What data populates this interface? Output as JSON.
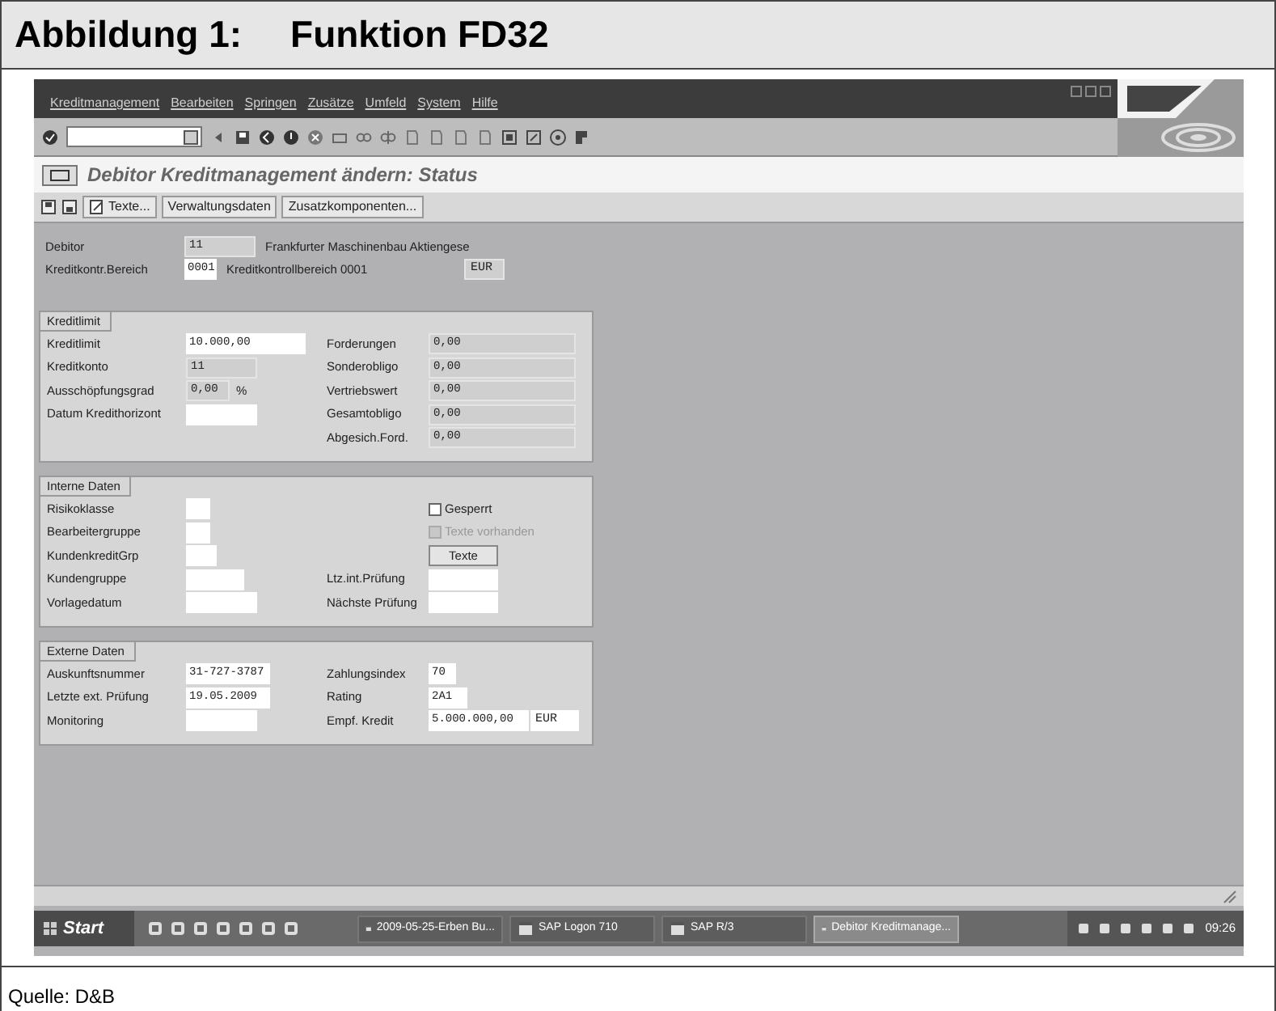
{
  "figure": {
    "caption_label": "Abbildung 1:",
    "caption_title": "Funktion FD32",
    "source": "Quelle: D&B"
  },
  "window": {
    "menu": [
      "Kreditmanagement",
      "Bearbeiten",
      "Springen",
      "Zusätze",
      "Umfeld",
      "System",
      "Hilfe"
    ],
    "title": "Debitor Kreditmanagement ändern: Status"
  },
  "app_toolbar": [
    "Texte...",
    "Verwaltungsdaten",
    "Zusatzkomponenten..."
  ],
  "header_fields": [
    {
      "label": "Debitor",
      "value": "11",
      "editable": false,
      "description": "Frankfurter Maschinenbau Aktiengese"
    },
    {
      "label": "Kreditkontr.Bereich",
      "value": "0001",
      "editable": true,
      "description": "Kreditkontrollbereich 0001",
      "currency": "EUR"
    }
  ],
  "groups": [
    {
      "title": "Kreditlimit",
      "left": [
        {
          "kind": "field",
          "label": "Kreditlimit",
          "value": "10.000,00",
          "editable": true
        },
        {
          "kind": "field",
          "label": "Kreditkonto",
          "value": "11",
          "editable": false
        },
        {
          "kind": "field",
          "label": "Ausschöpfungsgrad",
          "value": "0,00",
          "editable": false,
          "unit": "%"
        },
        {
          "kind": "field",
          "label": "Datum Kredithorizont",
          "editable": true
        }
      ],
      "right": [
        {
          "kind": "field",
          "label": "Forderungen",
          "value": "0,00",
          "editable": false
        },
        {
          "kind": "field",
          "label": "Sonderobligo",
          "value": "0,00",
          "editable": false
        },
        {
          "kind": "field",
          "label": "Vertriebswert",
          "value": "0,00",
          "editable": false
        },
        {
          "kind": "field",
          "label": "Gesamtobligo",
          "value": "0,00",
          "editable": false
        },
        {
          "kind": "field",
          "label": "Abgesich.Ford.",
          "value": "0,00",
          "editable": false
        }
      ]
    },
    {
      "title": "Interne Daten",
      "left": [
        {
          "kind": "field",
          "label": "Risikoklasse",
          "editable": true
        },
        {
          "kind": "field",
          "label": "Bearbeitergruppe",
          "editable": true
        },
        {
          "kind": "field",
          "label": "KundenkreditGrp",
          "editable": true
        },
        {
          "kind": "field",
          "label": "Kundengruppe",
          "editable": true
        },
        {
          "kind": "field",
          "label": "Vorlagedatum",
          "editable": true
        }
      ],
      "right": [
        {
          "kind": "checkbox",
          "label": "Gesperrt",
          "checked": false,
          "disabled": false
        },
        {
          "kind": "checkbox",
          "label": "Texte vorhanden",
          "checked": false,
          "disabled": true
        },
        {
          "kind": "button",
          "label": "Texte"
        },
        {
          "kind": "field",
          "label": "Ltz.int.Prüfung",
          "editable": true
        },
        {
          "kind": "field",
          "label": "Nächste Prüfung",
          "editable": true
        }
      ]
    },
    {
      "title": "Externe Daten",
      "left": [
        {
          "kind": "field",
          "label": "Auskunftsnummer",
          "value": "31-727-3787",
          "editable": true
        },
        {
          "kind": "field",
          "label": "Letzte ext. Prüfung",
          "value": "19.05.2009",
          "editable": true
        },
        {
          "kind": "field",
          "label": "Monitoring",
          "editable": true
        }
      ],
      "right": [
        {
          "kind": "field",
          "label": "Zahlungsindex",
          "value": "70",
          "editable": true
        },
        {
          "kind": "field",
          "label": "Rating",
          "value": "2A1",
          "editable": true
        },
        {
          "kind": "field",
          "label": "Empf. Kredit",
          "value": "5.000.000,00",
          "editable": true,
          "currency": "EUR"
        }
      ]
    }
  ],
  "taskbar": {
    "start": "Start",
    "tasks": [
      {
        "label": "2009-05-25-Erben Bu...",
        "selected": false
      },
      {
        "label": "SAP Logon 710",
        "selected": false
      },
      {
        "label": "SAP R/3",
        "selected": false
      },
      {
        "label": "Debitor Kreditmanage...",
        "selected": true
      }
    ],
    "time": "09:26"
  }
}
